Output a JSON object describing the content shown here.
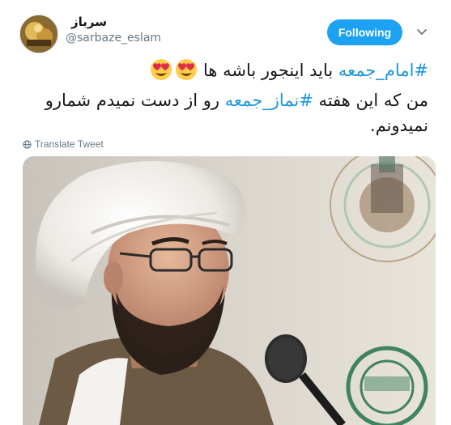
{
  "tweet": {
    "display_name": "سرباز",
    "handle": "@sarbaze_eslam",
    "follow_label": "Following",
    "text": {
      "line1_hashtag": "#امام_جمعه",
      "line1_rest": " باید اینجور باشه ها ",
      "line2_start": "من که این هفته ",
      "line2_hashtag": "#نماز_جمعه",
      "line2_end": " رو از دست نمیدم شمارو",
      "line3": "نمیدونم."
    },
    "emojis": [
      "heart-eyes-emoji",
      "heart-eyes-emoji"
    ],
    "translate_label": "Translate Tweet"
  },
  "colors": {
    "accent": "#1da1f2",
    "hashtag": "#1b95e0",
    "secondary_text": "#657786",
    "text": "#14171a"
  },
  "icons": {
    "chevron": "chevron-down-icon",
    "translate": "globe-icon"
  }
}
